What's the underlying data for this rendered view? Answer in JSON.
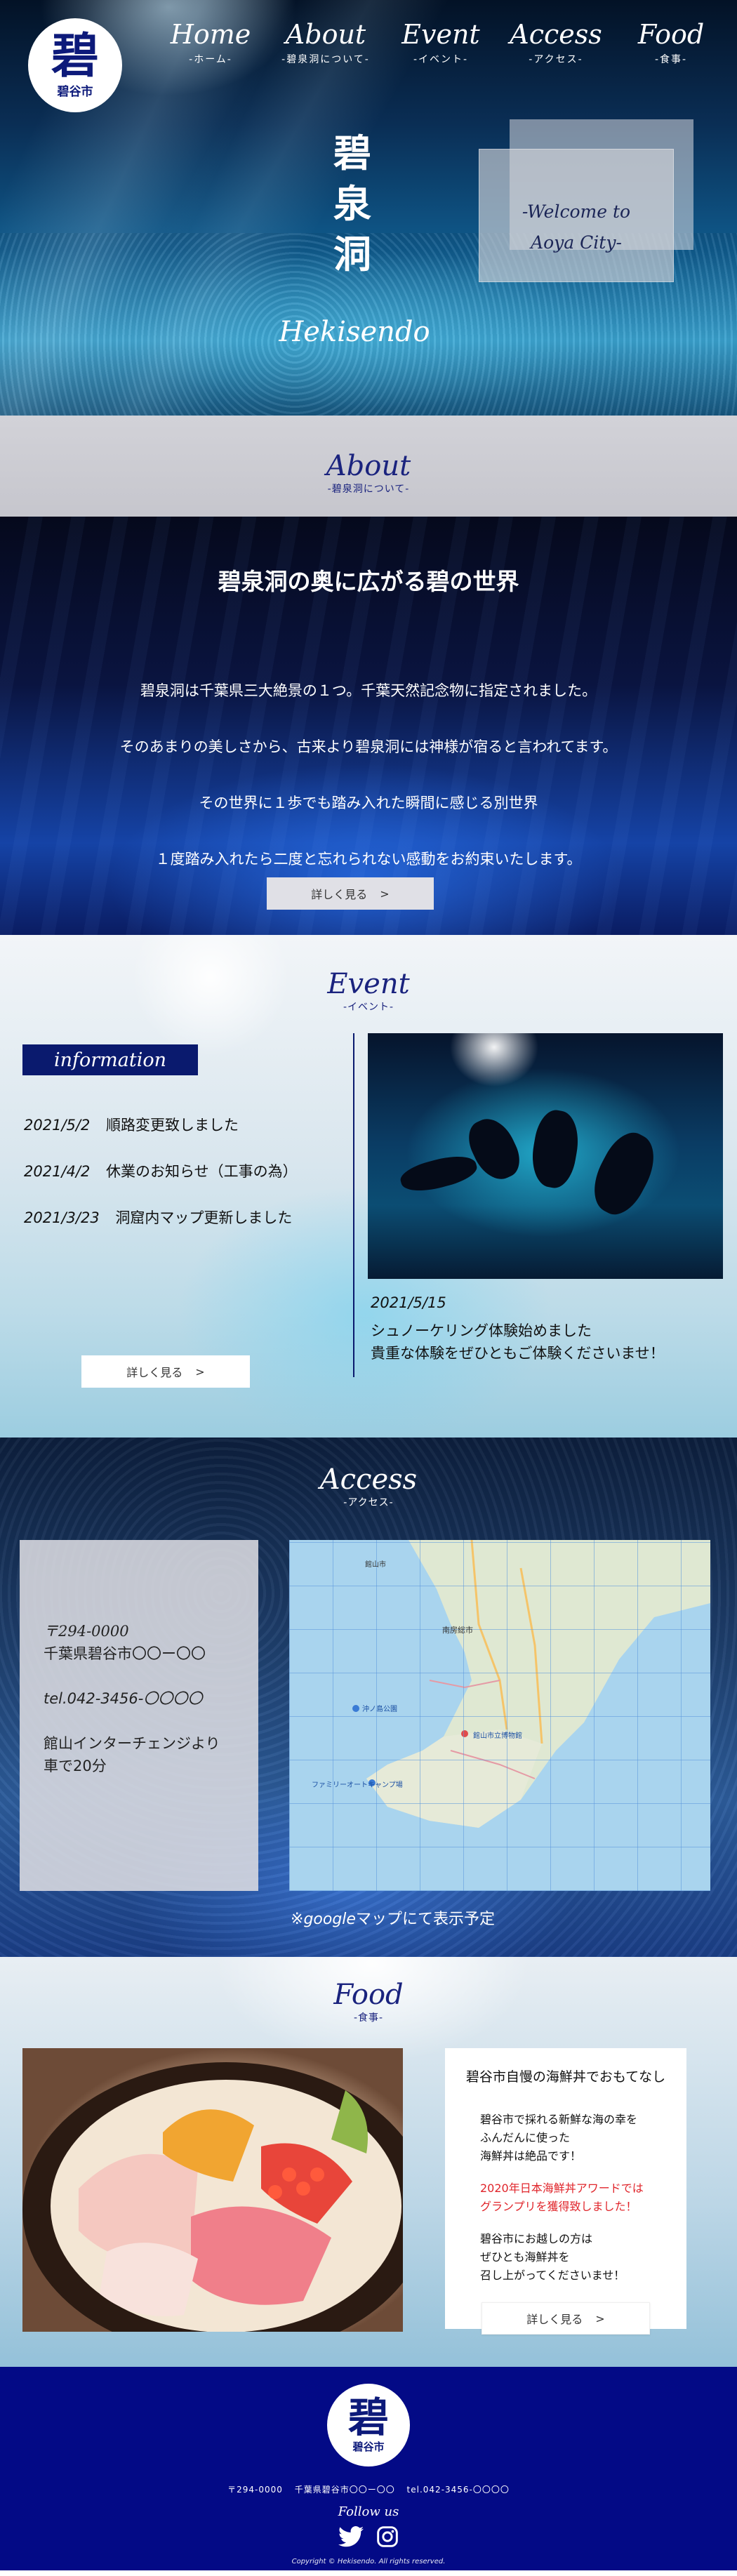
{
  "logo": {
    "kanji": "碧",
    "name": "碧谷市"
  },
  "nav": [
    {
      "en": "Home",
      "jp": "-ホーム-"
    },
    {
      "en": "About",
      "jp": "-碧泉洞について-"
    },
    {
      "en": "Event",
      "jp": "-イベント-"
    },
    {
      "en": "Access",
      "jp": "-アクセス-"
    },
    {
      "en": "Food",
      "jp": "-食事-"
    }
  ],
  "hero": {
    "title": "碧泉洞",
    "subtitle": "Hekisendo",
    "welcome_line1": "-Welcome to",
    "welcome_line2": "Aoya City-"
  },
  "about": {
    "heading_en": "About",
    "heading_jp": "-碧泉洞について-",
    "title": "碧泉洞の奥に広がる碧の世界",
    "lines": [
      "碧泉洞は千葉県三大絶景の１つ。千葉天然記念物に指定されました。",
      "そのあまりの美しさから、古来より碧泉洞には神様が宿ると言われてます。",
      "その世界に１歩でも踏み入れた瞬間に感じる別世界",
      "１度踏み入れたら二度と忘れられない感動をお約束いたします。"
    ],
    "button_label": "詳しく見る",
    "button_arrow": ">"
  },
  "event": {
    "heading_en": "Event",
    "heading_jp": "-イベント-",
    "badge": "information",
    "news": [
      {
        "date": "2021/5/2",
        "text": "順路変更致しました"
      },
      {
        "date": "2021/4/2",
        "text": "休業のお知らせ（工事の為）"
      },
      {
        "date": "2021/3/23",
        "text": "洞窟内マップ更新しました"
      }
    ],
    "button_label": "詳しく見る",
    "button_arrow": ">",
    "feature_date": "2021/5/15",
    "feature_line1": "シュノーケリング体験始めました",
    "feature_line2": "貴重な体験をぜひともご体験くださいませ！"
  },
  "access": {
    "heading_en": "Access",
    "heading_jp": "-アクセス-",
    "postal": "〒294-0000",
    "address": "千葉県碧谷市〇〇ー〇〇",
    "tel": "tel.042-3456-〇〇〇〇",
    "route_line1": "館山インターチェンジより",
    "route_line2": "車で20分",
    "map_labels": [
      "館山市",
      "南房総市",
      "館山市立博物館",
      "沖ノ島公園",
      "ファミリーオートキャンプ場"
    ],
    "note_prefix": "※",
    "note_google": "google",
    "note_text": "マップにて表示予定"
  },
  "food": {
    "heading_en": "Food",
    "heading_jp": "-食事-",
    "card_title": "碧谷市自慢の海鮮丼でおもてなし",
    "p1": [
      "碧谷市で採れる新鮮な海の幸を",
      "ふんだんに使った",
      "海鮮丼は絶品です！"
    ],
    "award": [
      "2020年日本海鮮丼アワードでは",
      "グランプリを獲得致しました！"
    ],
    "p3": [
      "碧谷市にお越しの方は",
      "ぜひとも海鮮丼を",
      "召し上がってくださいませ！"
    ],
    "button_label": "詳しく見る",
    "button_arrow": ">"
  },
  "footer": {
    "postal": "〒294-0000",
    "address": "千葉県碧谷市〇〇ー〇〇",
    "tel": "tel.042-3456-〇〇〇〇",
    "follow": "Follow us",
    "social_icons": [
      "twitter-icon",
      "instagram-icon"
    ],
    "copyright": "Copyright © Hekisendo. All rights reserved."
  },
  "colors": {
    "navy": "#0a1a6e",
    "footer_blue": "#030a86",
    "award_red": "#e0252b"
  }
}
